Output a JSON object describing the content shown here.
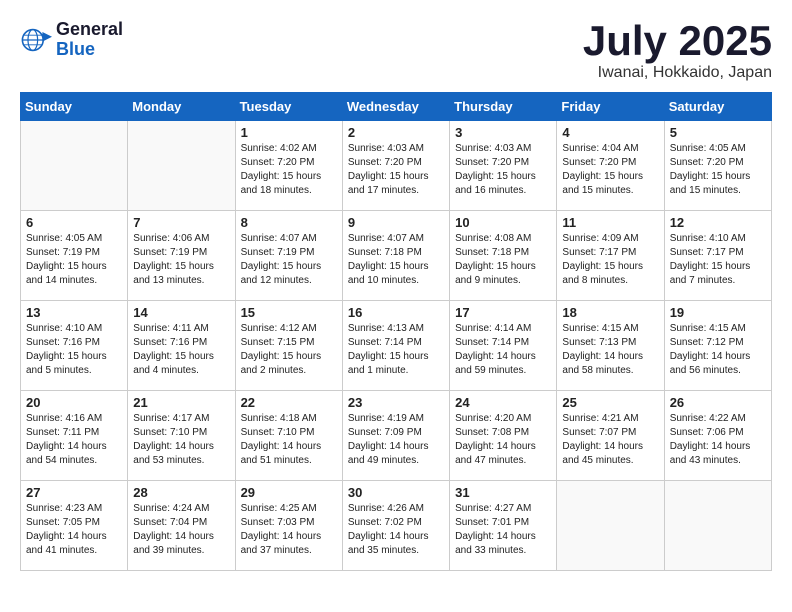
{
  "logo": {
    "general": "General",
    "blue": "Blue"
  },
  "title": "July 2025",
  "location": "Iwanai, Hokkaido, Japan",
  "weekdays": [
    "Sunday",
    "Monday",
    "Tuesday",
    "Wednesday",
    "Thursday",
    "Friday",
    "Saturday"
  ],
  "weeks": [
    [
      {
        "day": "",
        "info": ""
      },
      {
        "day": "",
        "info": ""
      },
      {
        "day": "1",
        "info": "Sunrise: 4:02 AM\nSunset: 7:20 PM\nDaylight: 15 hours\nand 18 minutes."
      },
      {
        "day": "2",
        "info": "Sunrise: 4:03 AM\nSunset: 7:20 PM\nDaylight: 15 hours\nand 17 minutes."
      },
      {
        "day": "3",
        "info": "Sunrise: 4:03 AM\nSunset: 7:20 PM\nDaylight: 15 hours\nand 16 minutes."
      },
      {
        "day": "4",
        "info": "Sunrise: 4:04 AM\nSunset: 7:20 PM\nDaylight: 15 hours\nand 15 minutes."
      },
      {
        "day": "5",
        "info": "Sunrise: 4:05 AM\nSunset: 7:20 PM\nDaylight: 15 hours\nand 15 minutes."
      }
    ],
    [
      {
        "day": "6",
        "info": "Sunrise: 4:05 AM\nSunset: 7:19 PM\nDaylight: 15 hours\nand 14 minutes."
      },
      {
        "day": "7",
        "info": "Sunrise: 4:06 AM\nSunset: 7:19 PM\nDaylight: 15 hours\nand 13 minutes."
      },
      {
        "day": "8",
        "info": "Sunrise: 4:07 AM\nSunset: 7:19 PM\nDaylight: 15 hours\nand 12 minutes."
      },
      {
        "day": "9",
        "info": "Sunrise: 4:07 AM\nSunset: 7:18 PM\nDaylight: 15 hours\nand 10 minutes."
      },
      {
        "day": "10",
        "info": "Sunrise: 4:08 AM\nSunset: 7:18 PM\nDaylight: 15 hours\nand 9 minutes."
      },
      {
        "day": "11",
        "info": "Sunrise: 4:09 AM\nSunset: 7:17 PM\nDaylight: 15 hours\nand 8 minutes."
      },
      {
        "day": "12",
        "info": "Sunrise: 4:10 AM\nSunset: 7:17 PM\nDaylight: 15 hours\nand 7 minutes."
      }
    ],
    [
      {
        "day": "13",
        "info": "Sunrise: 4:10 AM\nSunset: 7:16 PM\nDaylight: 15 hours\nand 5 minutes."
      },
      {
        "day": "14",
        "info": "Sunrise: 4:11 AM\nSunset: 7:16 PM\nDaylight: 15 hours\nand 4 minutes."
      },
      {
        "day": "15",
        "info": "Sunrise: 4:12 AM\nSunset: 7:15 PM\nDaylight: 15 hours\nand 2 minutes."
      },
      {
        "day": "16",
        "info": "Sunrise: 4:13 AM\nSunset: 7:14 PM\nDaylight: 15 hours\nand 1 minute."
      },
      {
        "day": "17",
        "info": "Sunrise: 4:14 AM\nSunset: 7:14 PM\nDaylight: 14 hours\nand 59 minutes."
      },
      {
        "day": "18",
        "info": "Sunrise: 4:15 AM\nSunset: 7:13 PM\nDaylight: 14 hours\nand 58 minutes."
      },
      {
        "day": "19",
        "info": "Sunrise: 4:15 AM\nSunset: 7:12 PM\nDaylight: 14 hours\nand 56 minutes."
      }
    ],
    [
      {
        "day": "20",
        "info": "Sunrise: 4:16 AM\nSunset: 7:11 PM\nDaylight: 14 hours\nand 54 minutes."
      },
      {
        "day": "21",
        "info": "Sunrise: 4:17 AM\nSunset: 7:10 PM\nDaylight: 14 hours\nand 53 minutes."
      },
      {
        "day": "22",
        "info": "Sunrise: 4:18 AM\nSunset: 7:10 PM\nDaylight: 14 hours\nand 51 minutes."
      },
      {
        "day": "23",
        "info": "Sunrise: 4:19 AM\nSunset: 7:09 PM\nDaylight: 14 hours\nand 49 minutes."
      },
      {
        "day": "24",
        "info": "Sunrise: 4:20 AM\nSunset: 7:08 PM\nDaylight: 14 hours\nand 47 minutes."
      },
      {
        "day": "25",
        "info": "Sunrise: 4:21 AM\nSunset: 7:07 PM\nDaylight: 14 hours\nand 45 minutes."
      },
      {
        "day": "26",
        "info": "Sunrise: 4:22 AM\nSunset: 7:06 PM\nDaylight: 14 hours\nand 43 minutes."
      }
    ],
    [
      {
        "day": "27",
        "info": "Sunrise: 4:23 AM\nSunset: 7:05 PM\nDaylight: 14 hours\nand 41 minutes."
      },
      {
        "day": "28",
        "info": "Sunrise: 4:24 AM\nSunset: 7:04 PM\nDaylight: 14 hours\nand 39 minutes."
      },
      {
        "day": "29",
        "info": "Sunrise: 4:25 AM\nSunset: 7:03 PM\nDaylight: 14 hours\nand 37 minutes."
      },
      {
        "day": "30",
        "info": "Sunrise: 4:26 AM\nSunset: 7:02 PM\nDaylight: 14 hours\nand 35 minutes."
      },
      {
        "day": "31",
        "info": "Sunrise: 4:27 AM\nSunset: 7:01 PM\nDaylight: 14 hours\nand 33 minutes."
      },
      {
        "day": "",
        "info": ""
      },
      {
        "day": "",
        "info": ""
      }
    ]
  ]
}
